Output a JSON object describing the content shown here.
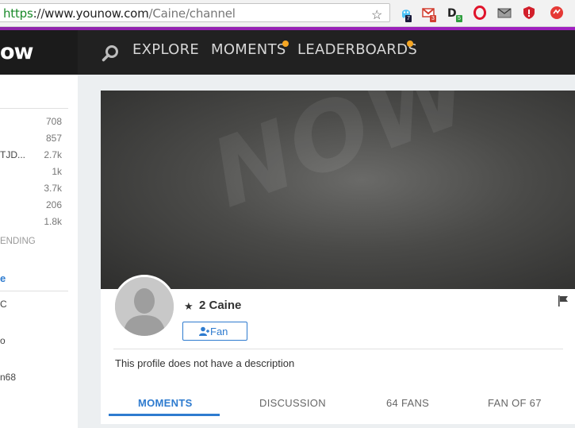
{
  "browser": {
    "url_https": "https",
    "url_sep": "://",
    "url_host": "www.younow.com",
    "url_path": "/Caine/channel",
    "bookmark_icon": "star-icon",
    "extensions": [
      {
        "name": "ghost-extension-icon",
        "badge": "7",
        "badge_color": "#1a1a3a"
      },
      {
        "name": "gmail-extension-icon",
        "badge": "3",
        "badge_color": "#d23f31"
      },
      {
        "name": "d-extension-icon",
        "badge": "5",
        "badge_color": "#2e9e3e"
      },
      {
        "name": "opera-extension-icon",
        "badge": "",
        "badge_color": ""
      },
      {
        "name": "mail-extension-icon",
        "badge": "",
        "badge_color": ""
      },
      {
        "name": "shield-extension-icon",
        "badge": "",
        "badge_color": ""
      },
      {
        "name": "red-circle-extension-icon",
        "badge": "",
        "badge_color": ""
      }
    ]
  },
  "header": {
    "logo": "ow",
    "nav": {
      "explore": "EXPLORE",
      "moments": "MOMENTS",
      "leaderboards": "LEADERBOARDS"
    },
    "accent_color": "#f5a623"
  },
  "sidebar": {
    "rows": [
      {
        "name": "",
        "count": "708"
      },
      {
        "name": "",
        "count": "857"
      },
      {
        "name": "TJD...",
        "count": "2.7k"
      },
      {
        "name": "",
        "count": "1k"
      },
      {
        "name": "",
        "count": "3.7k"
      },
      {
        "name": "",
        "count": "206"
      },
      {
        "name": "",
        "count": "1.8k"
      }
    ],
    "trending_label": "ENDING",
    "link_label": "e",
    "items": [
      "C",
      "o",
      "n68"
    ]
  },
  "profile": {
    "username": "2 Caine",
    "fan_button": "Fan",
    "description": "This profile does not have a description",
    "banner_text": "NOW",
    "tabs": {
      "moments": "MOMENTS",
      "discussion": "DISCUSSION",
      "fans": "64 FANS",
      "fan_of": "FAN OF 67"
    },
    "accent_color": "#2e7bcf"
  }
}
